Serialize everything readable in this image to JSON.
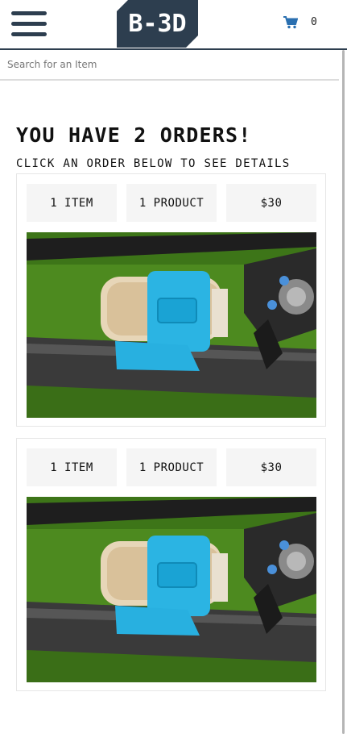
{
  "header": {
    "logo_text": "B-3D",
    "cart_count": "0",
    "icons": {
      "menu": "menu-icon",
      "cart": "cart-icon"
    },
    "colors": {
      "brand": "#2d3e4f",
      "accent": "#2a6fb0"
    }
  },
  "search": {
    "placeholder": "Search for an Item",
    "value": ""
  },
  "main": {
    "title": "YOU HAVE 2 ORDERS!",
    "subtitle": "CLICK AN ORDER BELOW TO SEE DETAILS",
    "orders": [
      {
        "items": "1 ITEM",
        "products": "1 PRODUCT",
        "price": "$30",
        "image": "product-photo-can-holder"
      },
      {
        "items": "1 ITEM",
        "products": "1 PRODUCT",
        "price": "$30",
        "image": "product-photo-can-holder"
      }
    ]
  }
}
